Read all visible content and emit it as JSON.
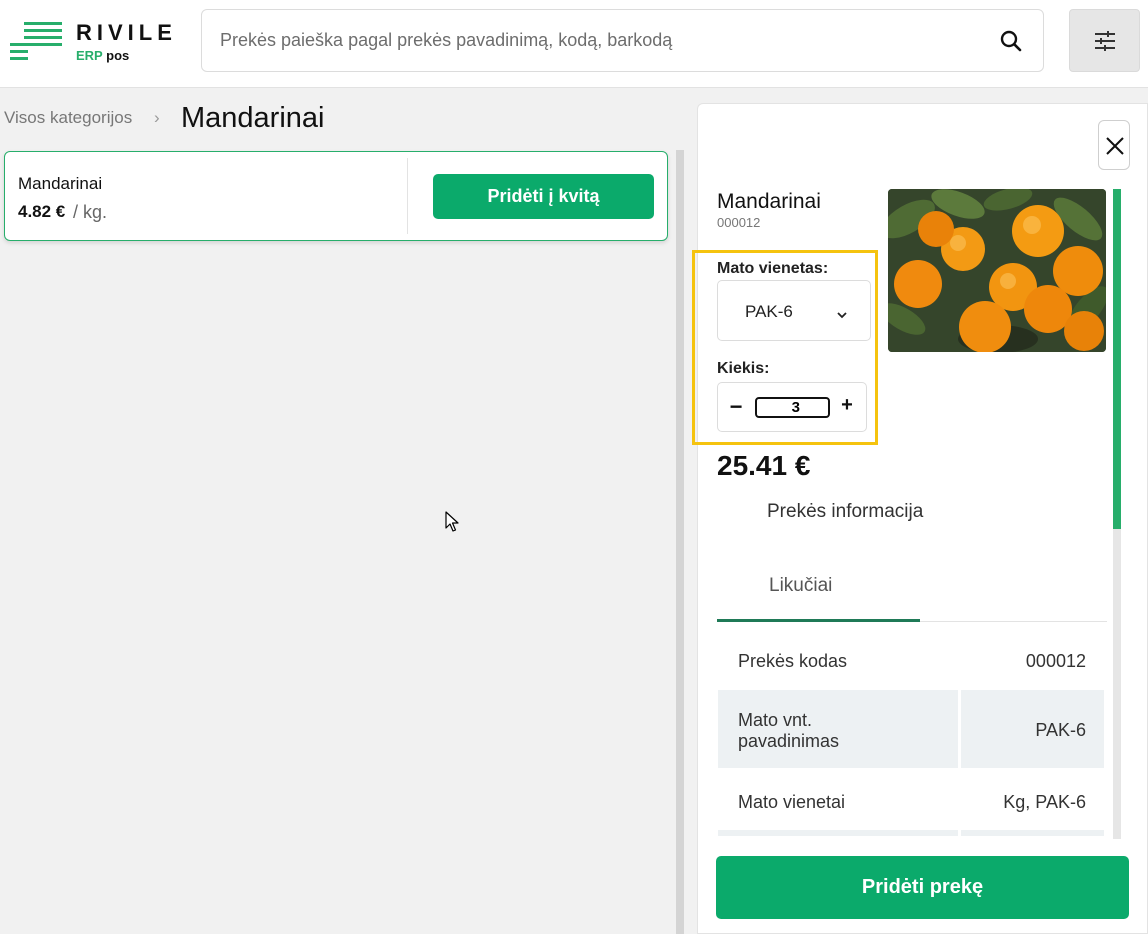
{
  "app": {
    "logo_name": "RIVILE",
    "logo_erp": "ERP",
    "logo_pos": "pos",
    "brand_color": "#0baa6b"
  },
  "search": {
    "placeholder": "Prekės paieška pagal prekės pavadinimą, kodą, barkodą",
    "value": "",
    "icon": "search-icon"
  },
  "filter_button": {
    "icon": "sliders-icon"
  },
  "breadcrumb": {
    "root": "Visos kategorijos",
    "separator": "›",
    "current": "Mandarinai"
  },
  "product_card": {
    "name": "Mandarinai",
    "price": "4.82 €",
    "unit": "/ kg.",
    "add_label": "Pridėti į kvitą"
  },
  "panel": {
    "close_icon": "close-icon",
    "title": "Mandarinai",
    "code": "000012",
    "image_alt": "mandarins photo",
    "unit_label": "Mato vienetas:",
    "unit_value": "PAK-6",
    "qty_label": "Kiekis:",
    "qty_minus": "−",
    "qty_value": "3",
    "qty_plus": "+",
    "total": "25.41 €",
    "tabs": [
      {
        "label": "Prekės informacija"
      },
      {
        "label": "Likučiai",
        "active": true
      }
    ],
    "table": [
      {
        "key": "Prekės kodas",
        "value": "000012"
      },
      {
        "key": "Mato vnt. pavadinimas",
        "value": "PAK-6"
      },
      {
        "key": "Mato vienetai",
        "value": "Kg, PAK-6"
      }
    ],
    "add_label": "Pridėti prekę"
  }
}
